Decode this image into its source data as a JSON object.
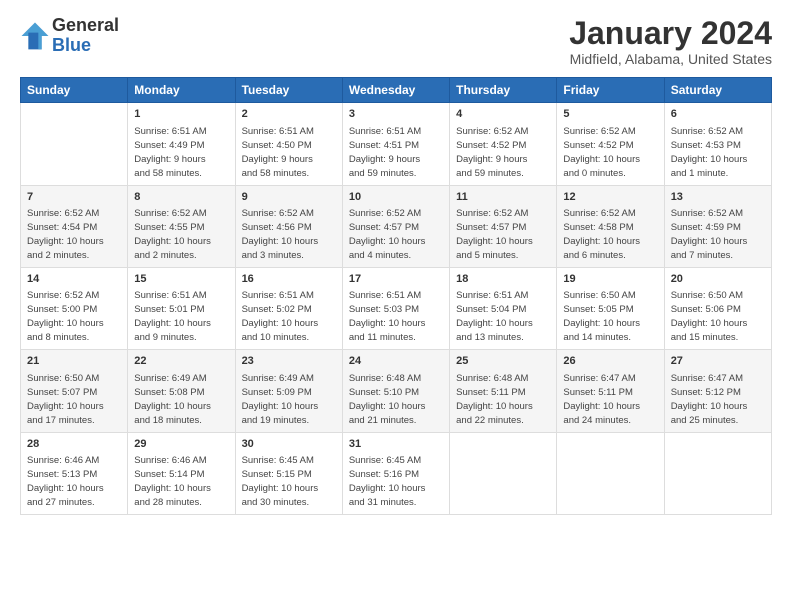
{
  "header": {
    "logo_general": "General",
    "logo_blue": "Blue",
    "month_title": "January 2024",
    "location": "Midfield, Alabama, United States"
  },
  "weekdays": [
    "Sunday",
    "Monday",
    "Tuesday",
    "Wednesday",
    "Thursday",
    "Friday",
    "Saturday"
  ],
  "weeks": [
    [
      {
        "day": "",
        "info": ""
      },
      {
        "day": "1",
        "info": "Sunrise: 6:51 AM\nSunset: 4:49 PM\nDaylight: 9 hours\nand 58 minutes."
      },
      {
        "day": "2",
        "info": "Sunrise: 6:51 AM\nSunset: 4:50 PM\nDaylight: 9 hours\nand 58 minutes."
      },
      {
        "day": "3",
        "info": "Sunrise: 6:51 AM\nSunset: 4:51 PM\nDaylight: 9 hours\nand 59 minutes."
      },
      {
        "day": "4",
        "info": "Sunrise: 6:52 AM\nSunset: 4:52 PM\nDaylight: 9 hours\nand 59 minutes."
      },
      {
        "day": "5",
        "info": "Sunrise: 6:52 AM\nSunset: 4:52 PM\nDaylight: 10 hours\nand 0 minutes."
      },
      {
        "day": "6",
        "info": "Sunrise: 6:52 AM\nSunset: 4:53 PM\nDaylight: 10 hours\nand 1 minute."
      }
    ],
    [
      {
        "day": "7",
        "info": "Sunrise: 6:52 AM\nSunset: 4:54 PM\nDaylight: 10 hours\nand 2 minutes."
      },
      {
        "day": "8",
        "info": "Sunrise: 6:52 AM\nSunset: 4:55 PM\nDaylight: 10 hours\nand 2 minutes."
      },
      {
        "day": "9",
        "info": "Sunrise: 6:52 AM\nSunset: 4:56 PM\nDaylight: 10 hours\nand 3 minutes."
      },
      {
        "day": "10",
        "info": "Sunrise: 6:52 AM\nSunset: 4:57 PM\nDaylight: 10 hours\nand 4 minutes."
      },
      {
        "day": "11",
        "info": "Sunrise: 6:52 AM\nSunset: 4:57 PM\nDaylight: 10 hours\nand 5 minutes."
      },
      {
        "day": "12",
        "info": "Sunrise: 6:52 AM\nSunset: 4:58 PM\nDaylight: 10 hours\nand 6 minutes."
      },
      {
        "day": "13",
        "info": "Sunrise: 6:52 AM\nSunset: 4:59 PM\nDaylight: 10 hours\nand 7 minutes."
      }
    ],
    [
      {
        "day": "14",
        "info": "Sunrise: 6:52 AM\nSunset: 5:00 PM\nDaylight: 10 hours\nand 8 minutes."
      },
      {
        "day": "15",
        "info": "Sunrise: 6:51 AM\nSunset: 5:01 PM\nDaylight: 10 hours\nand 9 minutes."
      },
      {
        "day": "16",
        "info": "Sunrise: 6:51 AM\nSunset: 5:02 PM\nDaylight: 10 hours\nand 10 minutes."
      },
      {
        "day": "17",
        "info": "Sunrise: 6:51 AM\nSunset: 5:03 PM\nDaylight: 10 hours\nand 11 minutes."
      },
      {
        "day": "18",
        "info": "Sunrise: 6:51 AM\nSunset: 5:04 PM\nDaylight: 10 hours\nand 13 minutes."
      },
      {
        "day": "19",
        "info": "Sunrise: 6:50 AM\nSunset: 5:05 PM\nDaylight: 10 hours\nand 14 minutes."
      },
      {
        "day": "20",
        "info": "Sunrise: 6:50 AM\nSunset: 5:06 PM\nDaylight: 10 hours\nand 15 minutes."
      }
    ],
    [
      {
        "day": "21",
        "info": "Sunrise: 6:50 AM\nSunset: 5:07 PM\nDaylight: 10 hours\nand 17 minutes."
      },
      {
        "day": "22",
        "info": "Sunrise: 6:49 AM\nSunset: 5:08 PM\nDaylight: 10 hours\nand 18 minutes."
      },
      {
        "day": "23",
        "info": "Sunrise: 6:49 AM\nSunset: 5:09 PM\nDaylight: 10 hours\nand 19 minutes."
      },
      {
        "day": "24",
        "info": "Sunrise: 6:48 AM\nSunset: 5:10 PM\nDaylight: 10 hours\nand 21 minutes."
      },
      {
        "day": "25",
        "info": "Sunrise: 6:48 AM\nSunset: 5:11 PM\nDaylight: 10 hours\nand 22 minutes."
      },
      {
        "day": "26",
        "info": "Sunrise: 6:47 AM\nSunset: 5:11 PM\nDaylight: 10 hours\nand 24 minutes."
      },
      {
        "day": "27",
        "info": "Sunrise: 6:47 AM\nSunset: 5:12 PM\nDaylight: 10 hours\nand 25 minutes."
      }
    ],
    [
      {
        "day": "28",
        "info": "Sunrise: 6:46 AM\nSunset: 5:13 PM\nDaylight: 10 hours\nand 27 minutes."
      },
      {
        "day": "29",
        "info": "Sunrise: 6:46 AM\nSunset: 5:14 PM\nDaylight: 10 hours\nand 28 minutes."
      },
      {
        "day": "30",
        "info": "Sunrise: 6:45 AM\nSunset: 5:15 PM\nDaylight: 10 hours\nand 30 minutes."
      },
      {
        "day": "31",
        "info": "Sunrise: 6:45 AM\nSunset: 5:16 PM\nDaylight: 10 hours\nand 31 minutes."
      },
      {
        "day": "",
        "info": ""
      },
      {
        "day": "",
        "info": ""
      },
      {
        "day": "",
        "info": ""
      }
    ]
  ]
}
